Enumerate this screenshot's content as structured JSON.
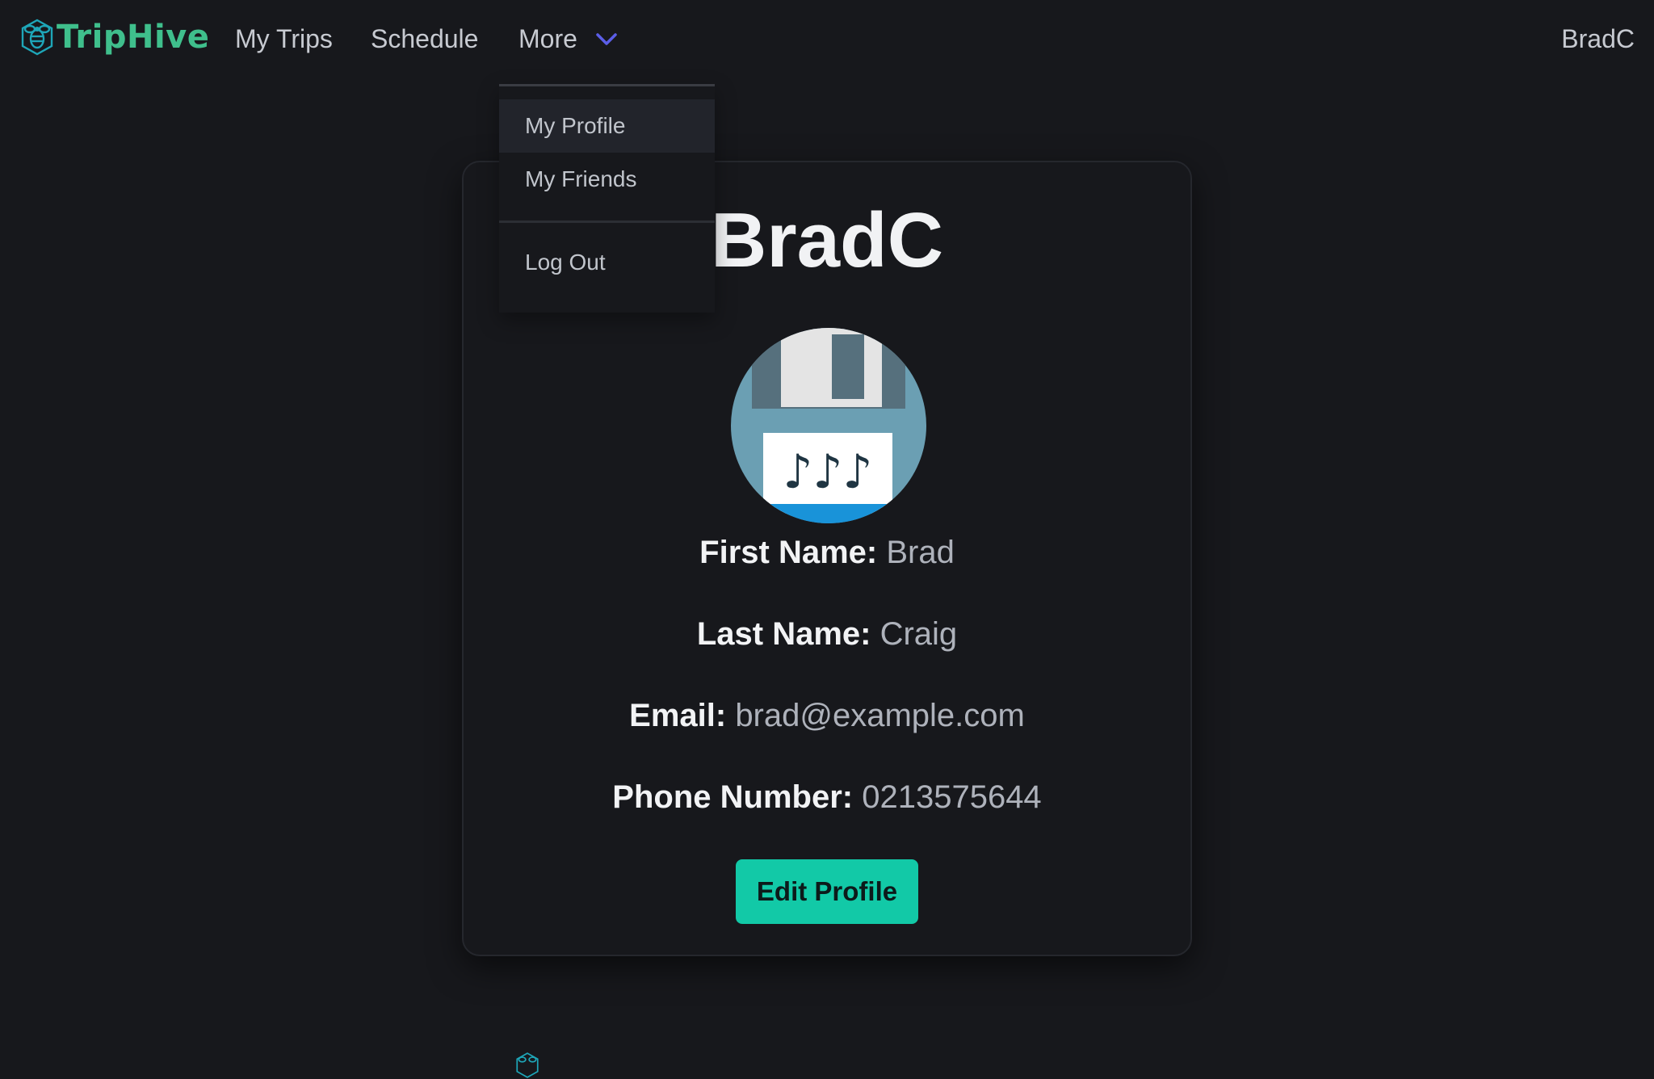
{
  "nav": {
    "brand": "TripHive",
    "items": [
      {
        "label": "My Trips"
      },
      {
        "label": "Schedule"
      },
      {
        "label": "More"
      }
    ],
    "user": "BradC"
  },
  "dropdown": {
    "items": [
      "My Profile",
      "My Friends",
      "Log Out"
    ]
  },
  "profile": {
    "username": "BradC",
    "fields": [
      {
        "label": "First Name:",
        "value": "Brad"
      },
      {
        "label": "Last Name:",
        "value": "Craig"
      },
      {
        "label": "Email:",
        "value": "brad@example.com"
      },
      {
        "label": "Phone Number:",
        "value": "0213575644"
      }
    ],
    "edit_label": "Edit Profile"
  },
  "avatar_glyph": "♪♪♪",
  "colors": {
    "background": "#17181c",
    "brand": "#3fbf8c",
    "accent_button": "#12c9a7",
    "chevron": "#5b5ee8"
  }
}
